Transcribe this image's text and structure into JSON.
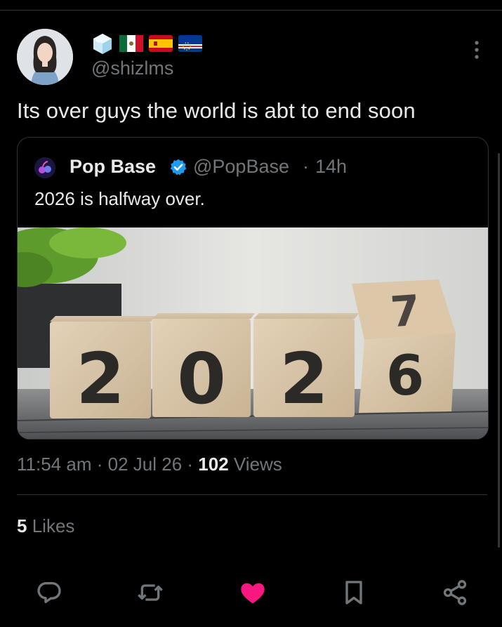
{
  "author": {
    "handle": "@shizlms",
    "emojis": [
      "ice-cube",
      "flag-mexico",
      "flag-spain",
      "flag-cape-verde"
    ]
  },
  "tweet": {
    "text": "Its over guys the world is abt to end soon"
  },
  "quote": {
    "name": "Pop Base",
    "handle": "@PopBase",
    "separator": "·",
    "time": "14h",
    "text": "2026 is halfway over.",
    "image_digits": [
      "2",
      "0",
      "2",
      "6",
      "7"
    ]
  },
  "meta": {
    "time": "11:54 am",
    "separator": "·",
    "date": "02 Jul 26",
    "views_count": "102",
    "views_label": "Views"
  },
  "likes": {
    "count": "5",
    "label": "Likes"
  },
  "actions": [
    "reply",
    "repost",
    "like",
    "bookmark",
    "share"
  ],
  "colors": {
    "background": "#000000",
    "text": "#e7e9ea",
    "secondary_text": "#71767b",
    "divider": "#2f3336",
    "verified": "#1d9bf0",
    "like": "#f91880"
  }
}
